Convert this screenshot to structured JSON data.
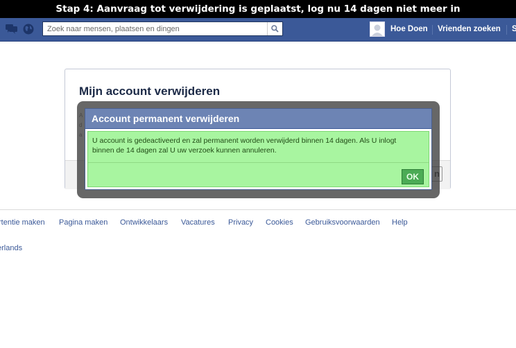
{
  "caption": "Stap 4: Aanvraag tot verwijdering is geplaatst, log nu 14 dagen niet meer in",
  "topbar": {
    "search_placeholder": "Zoek naar mensen, plaatsen en dingen",
    "user_name": "Hoe Doen",
    "friends_link": "Vrienden zoeken",
    "cut_link": "S",
    "icons": [
      "messages-icon",
      "globe-icon",
      "search-icon"
    ]
  },
  "card": {
    "title": "Mijn account verwijderen",
    "ghost_letters": [
      "A",
      "d",
      "a"
    ],
    "ghost_button": "n"
  },
  "dialog": {
    "title": "Account permanent verwijderen",
    "message": "U account is gedeactiveerd en zal permanent worden verwijderd binnen 14 dagen. Als U inlogt binnen de 14 dagen zal U uw verzoek kunnen annuleren.",
    "ok_label": "OK"
  },
  "footer": {
    "links": [
      "rtentie maken",
      "Pagina maken",
      "Ontwikkelaars",
      "Vacatures",
      "Privacy",
      "Cookies",
      "Gebruiksvoorwaarden",
      "Help"
    ],
    "language": "erlands"
  },
  "colors": {
    "topbar": "#3b5998",
    "dialog_header": "#6d84b4",
    "dialog_body": "#a8f5a0",
    "ok_button": "#4bab55",
    "link": "#3b5998"
  }
}
